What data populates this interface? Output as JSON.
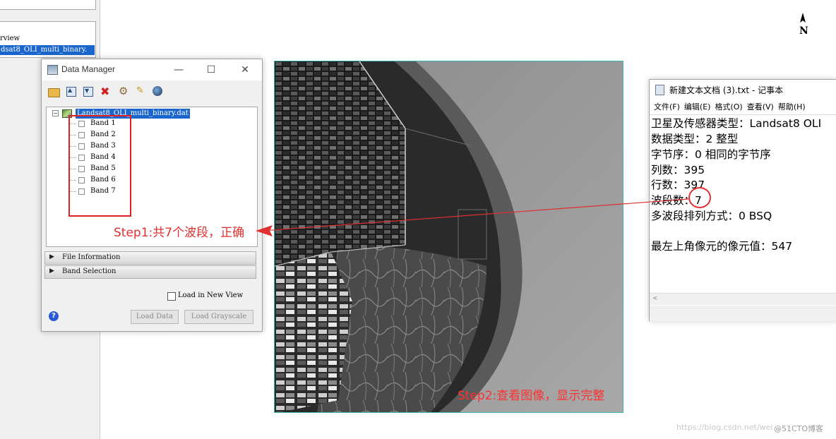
{
  "left_panel": {
    "tree_item_overview": "rview",
    "tree_item_selected": "dsat8_OLI_multi_binary."
  },
  "data_manager": {
    "title": "Data Manager",
    "window_controls": {
      "minimize": "—",
      "maximize": "☐",
      "close": "✕"
    },
    "toolbar": [
      "open-folder-icon",
      "move-up-icon",
      "move-down-icon",
      "close-file-icon",
      "settings-icon",
      "pin-icon",
      "globe-icon"
    ],
    "tree": {
      "root_toggle": "−",
      "root_label": "Landsat8_OLI_multi_binary.dat",
      "bands": [
        "Band 1",
        "Band 2",
        "Band 3",
        "Band 4",
        "Band 5",
        "Band 6",
        "Band 7"
      ]
    },
    "sections": [
      {
        "label": "File Information"
      },
      {
        "label": "Band Selection"
      }
    ],
    "load_in_new_view": "Load in New View",
    "help": "?",
    "buttons": {
      "load_data": "Load Data",
      "load_grayscale": "Load Grayscale"
    }
  },
  "annotations": {
    "step1": "Step1:共7个波段，正确",
    "step2": "Step2:查看图像，显示完整",
    "color": "#e03030"
  },
  "north_arrow": {
    "label": "N"
  },
  "notepad": {
    "title": "新建文本文档 (3).txt - 记事本",
    "menu": [
      "文件(F)",
      "编辑(E)",
      "格式(O)",
      "查看(V)",
      "帮助(H)"
    ],
    "lines": [
      "卫星及传感器类型：Landsat8 OLI",
      "数据类型：2 整型",
      "字节序：0 相同的字节序",
      "列数：395",
      "行数：397",
      "波段数：7",
      "多波段排列方式：0 BSQ",
      "",
      "最左上角像元的像元值：547"
    ],
    "scroll_left": "<"
  },
  "watermark": {
    "url": "https://blog.csdn.net/wei",
    "brand": "@51CTO博客"
  }
}
